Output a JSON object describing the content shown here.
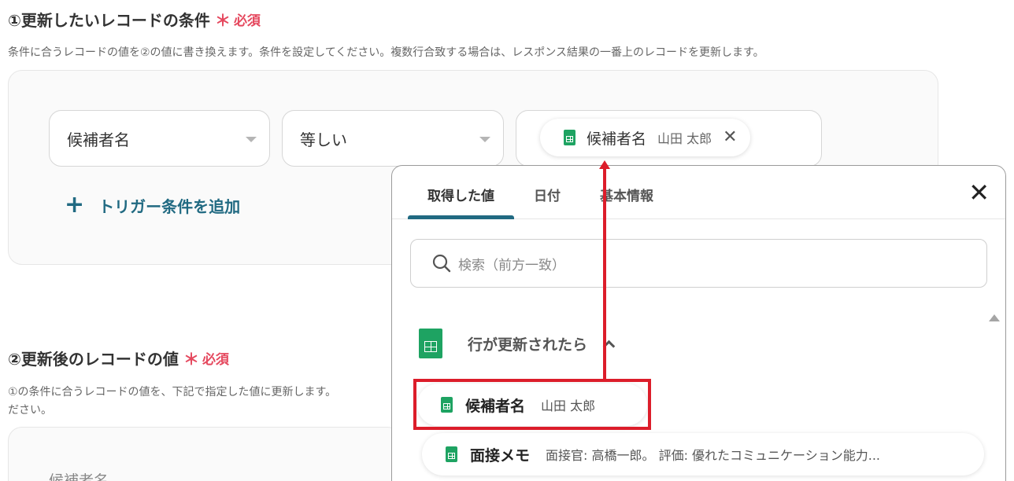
{
  "section1": {
    "title": "①更新したいレコードの条件",
    "required_star": "＊",
    "required_label": "必須",
    "description": "条件に合うレコードの値を②の値に書き換えます。条件を設定してください。複数行合致する場合は、レスポンス結果の一番上のレコードを更新します。"
  },
  "condition": {
    "field_select": "候補者名",
    "operator_select": "等しい",
    "value_chip_label": "候補者名",
    "value_chip_value": "山田 太郎",
    "value_chip_close": "✕",
    "add_condition_plus": "+",
    "add_condition_label": "トリガー条件を追加"
  },
  "section2": {
    "title": "②更新後のレコードの値",
    "required_star": "＊",
    "required_label": "必須",
    "description_line1": "①の条件に合うレコードの値を、下記で指定した値に更新します。",
    "description_line2": "ださい。",
    "field_label_partial": "候補者名"
  },
  "popup": {
    "tabs": [
      {
        "label": "取得した値",
        "active": true
      },
      {
        "label": "日付",
        "active": false
      },
      {
        "label": "基本情報",
        "active": false
      }
    ],
    "close_label": "✕",
    "search_placeholder": "検索（前方一致）",
    "group_label": "行が更新されたら",
    "items": [
      {
        "label": "候補者名",
        "value": "山田 太郎"
      },
      {
        "label": "面接メモ",
        "value": "面接官: 高橋一郎。 評価: 優れたコミュニケーション能力..."
      }
    ]
  },
  "colors": {
    "accent": "#216a82",
    "required": "#e5485e",
    "sheet_green": "#1ea362",
    "annotation_red": "#dc1d2a"
  }
}
